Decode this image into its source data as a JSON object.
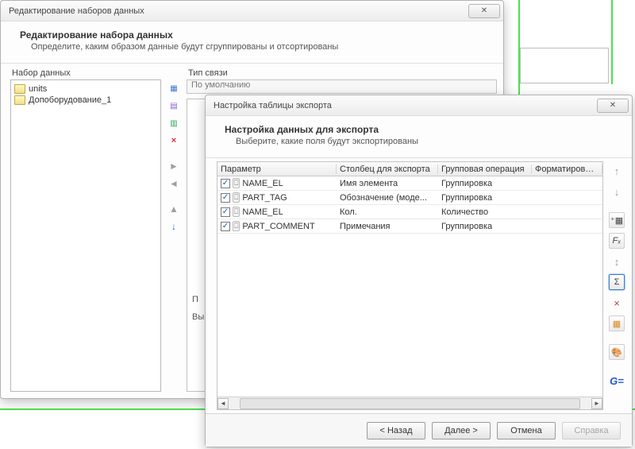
{
  "win1": {
    "title": "Редактирование наборов данных",
    "heading": "Редактирование набора данных",
    "subheading": "Определите, каким образом данные будут сгруппированы и отсортированы",
    "dataset_label": "Набор данных",
    "relation_label": "Тип связи",
    "relation_value": "По умолчанию",
    "datasets": [
      "units",
      "Допоборудование_1"
    ],
    "truncated_labels": {
      "p": "П",
      "v": "Вы"
    }
  },
  "win2": {
    "title": "Настройка таблицы экспорта",
    "heading": "Настройка данных для экспорта",
    "subheading": "Выберите, какие поля будут экспортированы",
    "columns": {
      "param": "Параметр",
      "export": "Столбец для экспорта",
      "group": "Групповая операция",
      "format": "Форматирование резу"
    },
    "rows": [
      {
        "param": "NAME_EL",
        "export": "Имя элемента",
        "group": "Группировка"
      },
      {
        "param": "PART_TAG",
        "export": "Обозначение (моде...",
        "group": "Группировка"
      },
      {
        "param": "NAME_EL",
        "export": "Кол.",
        "group": "Количество"
      },
      {
        "param": "PART_COMMENT",
        "export": "Примечания",
        "group": "Группировка"
      }
    ],
    "buttons": {
      "back": "< Назад",
      "next": "Далее >",
      "cancel": "Отмена",
      "help": "Справка"
    }
  },
  "glyphs": {
    "close": "✕",
    "check": "✓",
    "up": "▲",
    "down": "▼",
    "left": "◄",
    "right": "►",
    "downarrow": "↓",
    "uparrow": "↑",
    "sigma": "Σ",
    "fx": "Fₓ",
    "gequal": "G=",
    "plusfield": "⁺▦",
    "palette": "🎨",
    "calendar": "▦",
    "xsmall": "×",
    "arrowboth": "↕"
  }
}
